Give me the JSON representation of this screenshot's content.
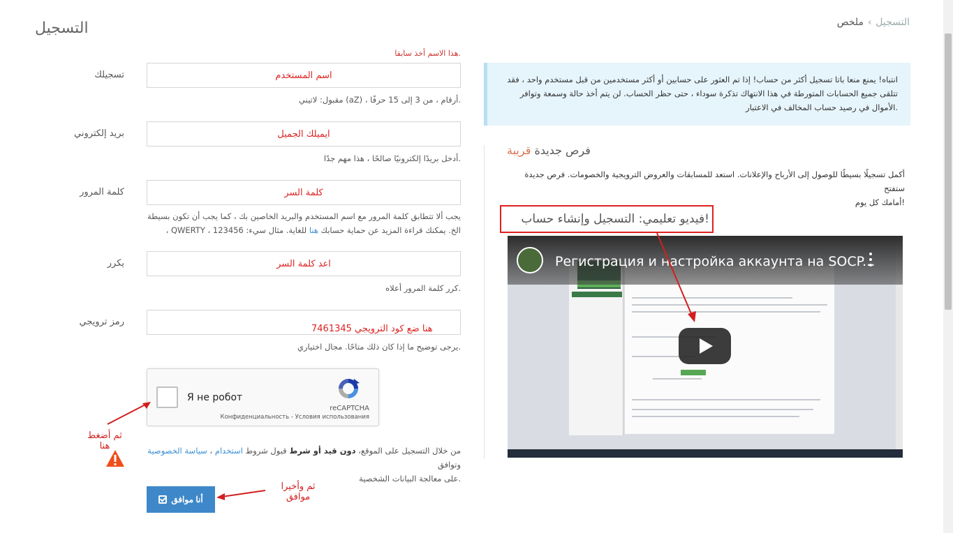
{
  "header": {
    "title": "التسجيل",
    "breadcrumb": {
      "parent": "التسجيل",
      "separator": "‹",
      "current": "ملخص"
    }
  },
  "form": {
    "username": {
      "label": "تسجيلك",
      "value": "اسم المستخدم",
      "error": ".هذا الاسم أخذ سابقا",
      "hint": ".أرقام ، من 3 إلى 15 حرفًا ، (aZ) مقبول: لاتيني"
    },
    "email": {
      "label": "بريد إلكتروني",
      "value": "ايميلك الجميل",
      "hint": ".أدخل بريدًا إلكترونيًا صالحًا ، هذا مهم جدًا"
    },
    "password": {
      "label": "كلمة المرور",
      "value": "كلمة السر",
      "hint_line1": "يجب ألا تتطابق كلمة المرور مع اسم المستخدم والبريد الخاصين بك ، كما يجب أن تكون بسيطة",
      "hint_line2_a": "الخ. يمكنك قراءة المزيد عن حماية حسابك",
      "hint_link": "هنا",
      "hint_line2_b": "للغاية. مثال سيء: QWERTY ، 123456 ،"
    },
    "repeat": {
      "label": "يكرر",
      "value": "اعد كلمة السر",
      "hint": ".كرر كلمة المرور أعلاه"
    },
    "promo": {
      "label": "رمز ترويجي",
      "value": "هنا ضع كود الترويجي 7461345",
      "hint": ".يرجى توضيح ما إذا كان ذلك متاحًا. مجال اختياري"
    },
    "recaptcha": {
      "label": "Я не робот",
      "brand": "reCAPTCHA",
      "links": "Конфиденциальность - Условия использования"
    },
    "consent": {
      "part1": "من خلال التسجيل على الموقع،",
      "bold": "دون قيد أو شرط",
      "part2": "قبول شروط",
      "link_terms": "استخدام",
      "sep": "،",
      "link_privacy": "سياسة الخصوصية",
      "part3": "وتوافق",
      "line2": ".على معالجة البيانات الشخصية"
    },
    "submit_label": "أنا موافق"
  },
  "annotations": {
    "click_here": "ثم أضغط هنا",
    "finally_agree": "ثم وأخيرا موافق"
  },
  "notice": {
    "line1": "انتباه! يمنع منعا باتا تسجيل أكثر من حساب! إذا تم العثور على حسابين أو أكثر مستخدمين من قبل مستخدم واحد ، فقد",
    "line2": "تتلقى جميع الحسابات المتورطة في هذا الانتهاك تذكرة سوداء ، حتى حظر الحساب. لن يتم أخذ حالة وسمعة وتوافر",
    "line3": ".الأموال في رصيد حساب المخالف في الاعتبار"
  },
  "opportunities": {
    "title_a": "فرص جديدة",
    "title_b": "قريبة",
    "line1": "أكمل تسجيلًا بسيطًا للوصول إلى الأرباح والإعلانات. استعد للمسابقات والعروض الترويجية والخصومات. فرص جديدة ستفتح",
    "line2": "!أمامك كل يوم"
  },
  "video": {
    "heading": "!فيديو تعليمي: التسجيل وإنشاء حساب",
    "title": "Регистрация и настройка аккаунта на SOCP..."
  },
  "colors": {
    "accent": "#3e88c9",
    "annotation": "#d21f1f",
    "notice_bg": "#e6f4fb"
  }
}
